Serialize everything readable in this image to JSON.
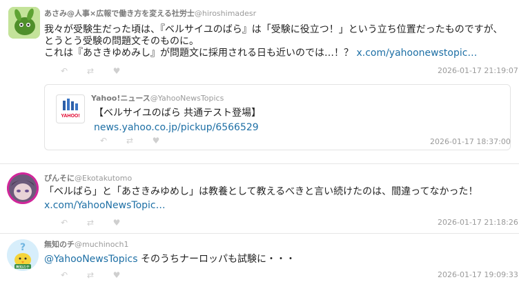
{
  "posts": [
    {
      "display_name": "あさみ@人事×広報で働き方を変える社労士",
      "handle": "@hiroshimadesr",
      "lines": [
        "我々が受験生だった頃は、『ベルサイユのばら』は「受験に役立つ！」という立ち位置だったものですが、",
        "とうとう受験の問題文そのものに。",
        "これは『あさきゆめみし』が問題文に採用される日も近いのでは…！？"
      ],
      "link": "x.com/yahoonewstopic…",
      "timestamp": "2026-01-17 21:19:07",
      "quote": {
        "display_name": "Yahoo!ニュース",
        "handle": "@YahooNewsTopics",
        "logo_text": "YAHOO!",
        "title": "【ベルサイユのばら 共通テスト登場】",
        "link": "news.yahoo.co.jp/pickup/6566529",
        "timestamp": "2026-01-17 18:37:00"
      }
    },
    {
      "display_name": "ぴんそに",
      "handle": "@Ekotakutomo",
      "lines": [
        "「ベルばら」と「あさきみゆめし」は教養として教えるべきと言い続けたのは、間違ってなかった！"
      ],
      "link": "x.com/YahooNewsTopic…",
      "timestamp": "2026-01-17 21:18:26"
    },
    {
      "display_name": "無知のチ",
      "handle": "@muchinoch1",
      "mention": "@YahooNewsTopics",
      "text": " そのうちナーロッパも試験に・・・",
      "avatar_text": "無知のチ",
      "timestamp": "2026-01-17 19:09:33"
    }
  ],
  "icons": [
    "reply-icon",
    "retweet-icon",
    "like-icon"
  ],
  "colors": {
    "link": "#1d6fa5",
    "meta": "#9a9a9a",
    "icon": "#cfcfcf"
  }
}
